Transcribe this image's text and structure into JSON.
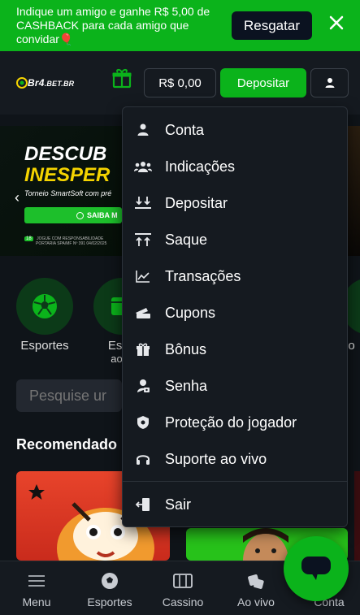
{
  "promo": {
    "text": "Indique um amigo e ganhe R$ 5,00 de CASHBACK para cada amigo que convidar🎈",
    "button": "Resgatar"
  },
  "header": {
    "logo": "Br4",
    "logo_sub": ".BET.BR",
    "balance": "R$ 0,00",
    "deposit": "Depositar"
  },
  "hero": {
    "title_line1": "DESCUB",
    "title_line2": "INESPER",
    "subtitle": "Torneio SmartSoft com pré",
    "cta": "SAIBA M",
    "footer_line1": "JOGUE COM RESPONSABILIDADE",
    "footer_line2": "PORTARIA SPA/MF Nº 391 04/02/2025",
    "age": "18"
  },
  "categories": [
    {
      "label": "Esportes"
    },
    {
      "label": "Espo",
      "label2": "ao vi"
    },
    {
      "label": "po"
    }
  ],
  "search": {
    "placeholder": "Pesquise ur"
  },
  "recommended": {
    "title": "Recomendado"
  },
  "menu": {
    "items": [
      {
        "label": "Conta",
        "icon": "user-icon"
      },
      {
        "label": "Indicações",
        "icon": "group-icon"
      },
      {
        "label": "Depositar",
        "icon": "download-icon"
      },
      {
        "label": "Saque",
        "icon": "upload-icon"
      },
      {
        "label": "Transações",
        "icon": "chart-line-icon"
      },
      {
        "label": "Cupons",
        "icon": "ticket-icon"
      },
      {
        "label": "Bônus",
        "icon": "gift-icon"
      },
      {
        "label": "Senha",
        "icon": "key-person-icon"
      },
      {
        "label": "Proteção do jogador",
        "icon": "shield-icon"
      },
      {
        "label": "Suporte ao vivo",
        "icon": "headset-icon"
      },
      {
        "label": "Sair",
        "icon": "logout-icon"
      }
    ]
  },
  "bottom_nav": [
    {
      "label": "Menu",
      "icon": "hamburger-icon"
    },
    {
      "label": "Esportes",
      "icon": "soccer-ball-icon"
    },
    {
      "label": "Cassino",
      "icon": "slot-machine-icon"
    },
    {
      "label": "Ao vivo",
      "icon": "dice-icon"
    },
    {
      "label": "Conta",
      "icon": "user-icon"
    }
  ],
  "colors": {
    "accent": "#0bb31b",
    "background": "#0f1419",
    "panel": "#151a20"
  }
}
